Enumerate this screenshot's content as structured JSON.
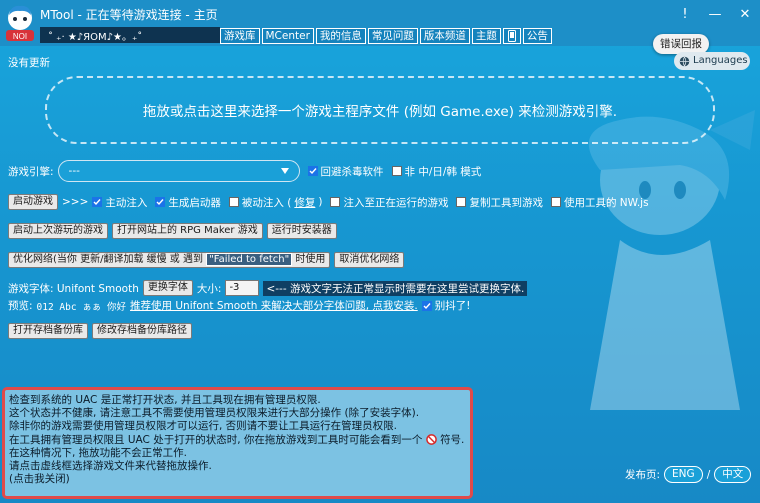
{
  "window": {
    "title": "MTool - 正在等待游戏连接 - 主页",
    "marquee": "˚ ₊‧ ★♪ЯOM♪★。₊˚",
    "minimize": "—",
    "alert": "!",
    "close": "✕"
  },
  "tabs": [
    "游戏库",
    "MCenter",
    "我的信息",
    "常见问题",
    "版本频道",
    "主题",
    "公告"
  ],
  "tooltip": "错误回报",
  "languages_label": "Languages",
  "status": "没有更新",
  "dropzone_text": "拖放或点击这里来选择一个游戏主程序文件 (例如 Game.exe) 来检测游戏引擎.",
  "engine": {
    "label": "游戏引擎:",
    "selected": "---",
    "antivirus": "回避杀毒软件",
    "non_cjk": "非 中/日/韩 模式"
  },
  "start_row": {
    "start_button": "启动游戏",
    "arrows": ">>>",
    "active_inject": "主动注入",
    "gen_launcher": "生成启动器",
    "passive_inject_prefix": "被动注入 (",
    "passive_inject_link": "修复",
    "passive_inject_suffix": ")",
    "inject_running": "注入至正在运行的游戏",
    "copy_tool": "复制工具到游戏",
    "use_nwjs": "使用工具的 NW.js"
  },
  "buttons_row": {
    "last_game": "启动上次游玩的游戏",
    "open_rpg": "打开网站上的 RPG Maker 游戏",
    "run_installer": "运行时安装器"
  },
  "network_row": {
    "optimize_prefix": "优化网络(当你 更新/翻译加载 缓慢 或 遇到",
    "failed_fetch": "\"Failed to fetch\"",
    "optimize_suffix": "时使用",
    "cancel": "取消优化网络"
  },
  "font_row": {
    "label": "游戏字体: Unifont Smooth",
    "change_font": "更换字体",
    "size_label": "大小:",
    "size_value": "-3",
    "hint": "<--- 游戏文字无法正常显示时需要在这里尝试更换字体."
  },
  "preview_row": {
    "label": "预览:",
    "sample": "012 Abc ぁぁ 你好",
    "recommend": "推荐使用 Unifont Smooth 来解决大部分字体问题, 点我安装.",
    "shake": "别抖了!"
  },
  "library_row": {
    "open_library": "打开存档备份库",
    "change_path": "修改存档备份库路径"
  },
  "notice": {
    "line1": "检查到系统的 UAC 是正常打开状态, 并且工具现在拥有管理员权限.",
    "line2": "这个状态并不健康, 请注意工具不需要使用管理员权限来进行大部分操作 (除了安装字体).",
    "line3": "除非你的游戏需要使用管理员权限才可以运行, 否则请不要让工具运行在管理员权限.",
    "line4": "在工具拥有管理员权限且 UAC 处于打开的状态时, 你在拖放游戏到工具时可能会看到一个",
    "line4_suffix": "符号.",
    "line5": "在这种情况下, 拖放功能不会正常工作.",
    "line6": "请点击虚线框选择游戏文件来代替拖放操作.",
    "line7": "(点击我关闭)"
  },
  "publish": {
    "label": "发布页:",
    "eng": "ENG",
    "sep": "/",
    "cn": "中文"
  },
  "colors": {
    "background": "#1aa0d8",
    "notice_border": "#e04a4a",
    "checkbox": "#1b73e8"
  }
}
